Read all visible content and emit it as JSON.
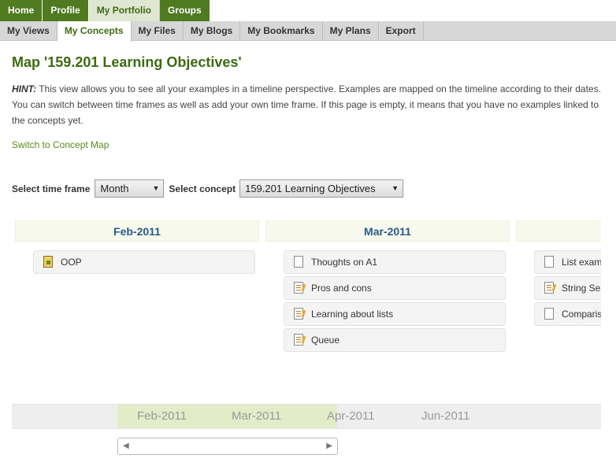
{
  "top_tabs": [
    {
      "label": "Home",
      "active": false
    },
    {
      "label": "Profile",
      "active": false
    },
    {
      "label": "My Portfolio",
      "active": true
    },
    {
      "label": "Groups",
      "active": false
    }
  ],
  "sub_tabs": [
    {
      "label": "My Views",
      "active": false
    },
    {
      "label": "My Concepts",
      "active": true
    },
    {
      "label": "My Files",
      "active": false
    },
    {
      "label": "My Blogs",
      "active": false
    },
    {
      "label": "My Bookmarks",
      "active": false
    },
    {
      "label": "My Plans",
      "active": false
    },
    {
      "label": "Export",
      "active": false
    }
  ],
  "page": {
    "title": "Map '159.201 Learning Objectives'",
    "hint_label": "HINT:",
    "hint_text": " This view allows you to see all your examples in a timeline perspective. Examples are mapped on the timeline according to their dates. You can switch between time frames as well as add your own time frame. If this page is empty, it means that you have no examples linked to the concepts yet.",
    "switch_link": "Switch to Concept Map"
  },
  "controls": {
    "time_frame_label": "Select time frame",
    "time_frame_value": "Month",
    "concept_label": "Select concept",
    "concept_value": "159.201 Learning Objectives"
  },
  "columns": [
    {
      "title": "Feb-2011",
      "items": [
        {
          "label": "OOP",
          "icon": "folder-icon"
        }
      ]
    },
    {
      "title": "Mar-2011",
      "items": [
        {
          "label": "Thoughts on A1",
          "icon": "document-icon"
        },
        {
          "label": "Pros and cons",
          "icon": "note-icon"
        },
        {
          "label": "Learning about lists",
          "icon": "note-icon"
        },
        {
          "label": "Queue",
          "icon": "note-icon"
        }
      ]
    },
    {
      "title": "",
      "items": [
        {
          "label": "List examples",
          "icon": "document-icon"
        },
        {
          "label": "String Se",
          "icon": "note-icon"
        },
        {
          "label": "Comparis",
          "icon": "document-icon"
        }
      ]
    }
  ],
  "timeline_band": {
    "labels": [
      "Feb-2011",
      "Mar-2011",
      "Apr-2011",
      "Jun-2011"
    ]
  },
  "colors": {
    "nav_green": "#4f7a1f",
    "title_green": "#3e6a12",
    "link_green": "#5a8a1c",
    "column_head_blue": "#2a5a8c",
    "band_highlight": "#e3ecc9"
  }
}
